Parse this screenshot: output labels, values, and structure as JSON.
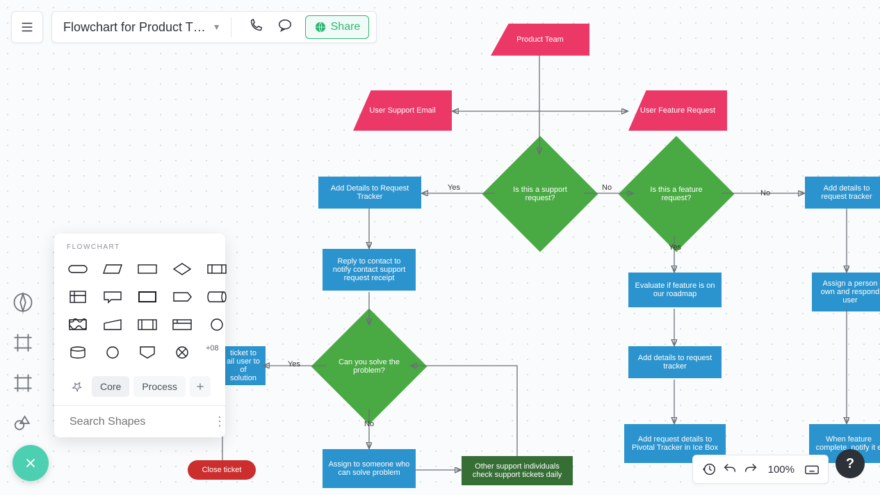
{
  "header": {
    "title": "Flowchart for Product T…",
    "share": "Share"
  },
  "panel": {
    "title": "FLOWCHART",
    "tabs": {
      "core": "Core",
      "process": "Process"
    },
    "more": "+08",
    "search_placeholder": "Search Shapes"
  },
  "bottom": {
    "zoom": "100%"
  },
  "labels": {
    "yes": "Yes",
    "no": "No"
  },
  "nodes": {
    "product_team": "Product Team",
    "user_support_email": "User Support Email",
    "user_feature_request": "User Feature Request",
    "add_details_tracker": "Add Details to Request Tracker",
    "is_support": "Is this a support request?",
    "is_feature": "Is this a feature request?",
    "add_details_req": "Add details to request tracker",
    "reply_contact": "Reply to contact to notify contact support request receipt",
    "evaluate_feature": "Evaluate if feature is on our roadmap",
    "assign_person": "Assign a person own and respond user",
    "solve_problem": "Can you solve the problem?",
    "ticket_email": "ticket to ail user to of solution",
    "add_details_tracker2": "Add details to request tracker",
    "close_ticket": "Close ticket",
    "assign_someone": "Assign to someone who can solve problem",
    "other_support": "Other support individuals check support tickets daily",
    "pivotal": "Add request details to Pivotal Tracker in Ice Box",
    "when_complete": "When feature complete, notify it e"
  }
}
